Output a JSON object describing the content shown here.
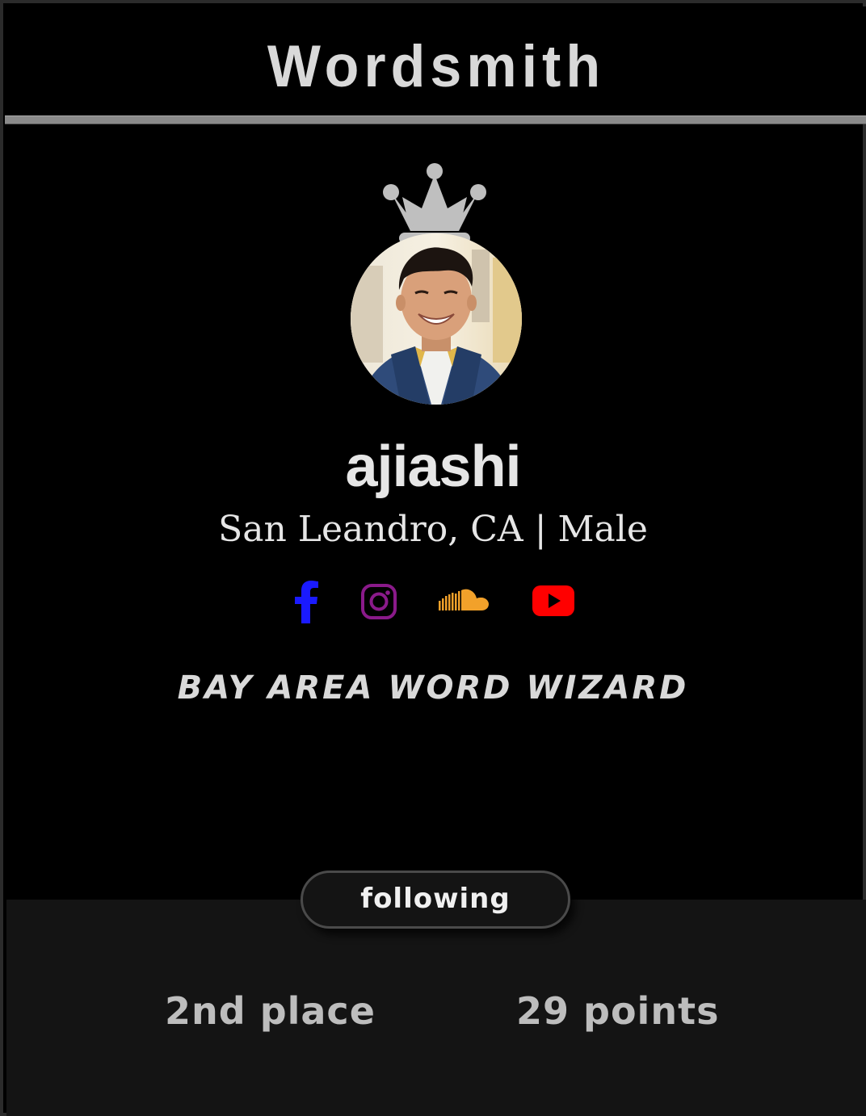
{
  "app": {
    "title": "Wordsmith"
  },
  "profile": {
    "username": "ajiashi",
    "meta": "San Leandro, CA | Male",
    "tagline": "BAY AREA WORD WIZARD",
    "rank_badge_icon": "crown-icon",
    "avatar_alt": "ajiashi"
  },
  "socials": [
    {
      "name": "facebook",
      "icon": "facebook-icon",
      "color": "#1a1aff"
    },
    {
      "name": "instagram",
      "icon": "instagram-icon",
      "color": "#8a1a8a"
    },
    {
      "name": "soundcloud",
      "icon": "soundcloud-icon",
      "color": "#f2a12a"
    },
    {
      "name": "youtube",
      "icon": "youtube-icon",
      "color": "#ff0000"
    }
  ],
  "actions": {
    "follow_label": "following"
  },
  "stats": {
    "rank": "2nd place",
    "points": "29 points"
  },
  "colors": {
    "background": "#000000",
    "panel": "#141414",
    "text": "#e6e6e6",
    "muted_text": "#bdbdbd",
    "crown": "#bfbfbf"
  }
}
